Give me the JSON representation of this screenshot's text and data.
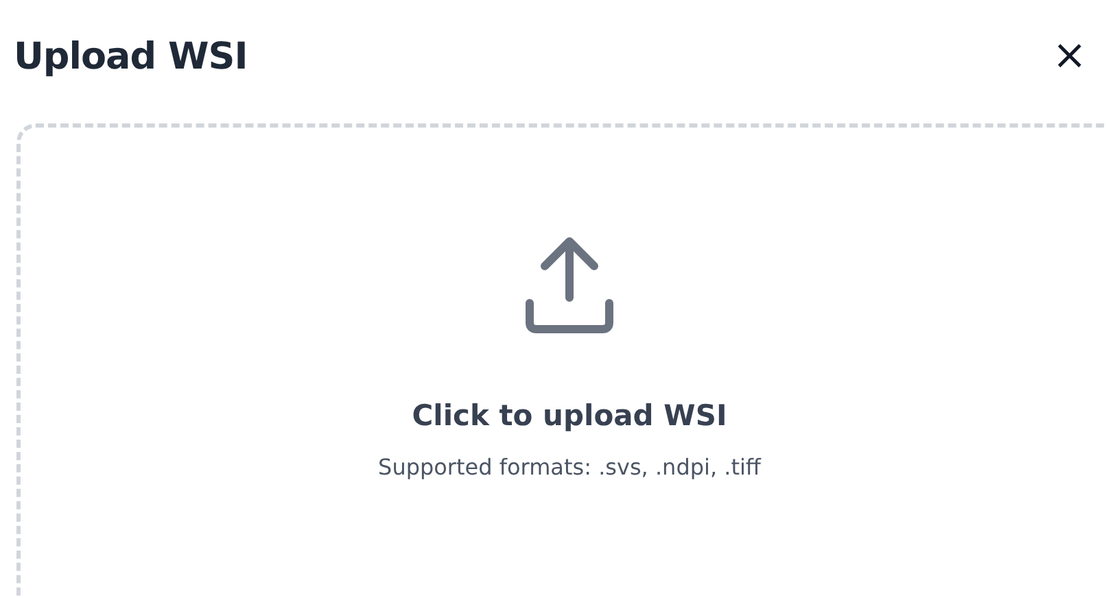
{
  "dialog": {
    "title": "Upload WSI",
    "close": "×"
  },
  "dropzone": {
    "heading": "Click to upload WSI",
    "hint": "Supported formats: .svs, .ndpi, .tiff"
  }
}
